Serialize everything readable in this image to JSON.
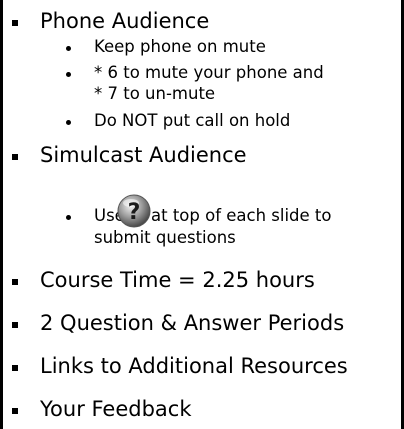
{
  "bullets": [
    {
      "label": "Phone Audience",
      "sub": [
        "Keep phone on mute",
        "* 6 to mute your phone and",
        "* 7 to un-mute",
        "Do NOT put call on hold"
      ]
    },
    {
      "label": "Simulcast Audience",
      "sub": [
        "Use",
        "at top of each slide to",
        "submit questions"
      ],
      "icon": "help-question-icon"
    },
    {
      "label": "Course Time = 2.25 hours"
    },
    {
      "label": "2 Question & Answer Periods"
    },
    {
      "label": "Links to Additional Resources"
    },
    {
      "label": "Your Feedback"
    }
  ]
}
